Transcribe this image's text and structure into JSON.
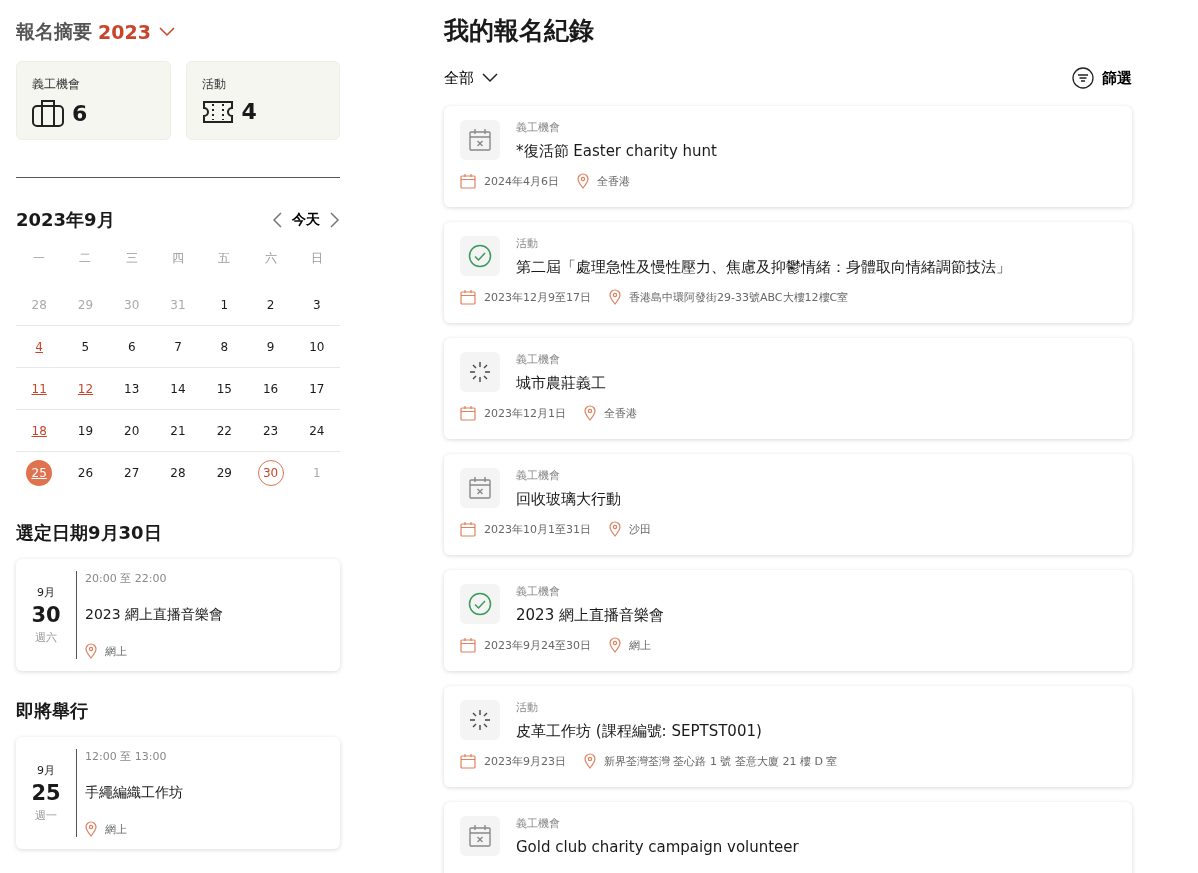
{
  "summary": {
    "title": "報名摘要",
    "year": "2023",
    "stats": [
      {
        "label": "義工機會",
        "count": "6",
        "kind": "bag"
      },
      {
        "label": "活動",
        "count": "4",
        "kind": "ticket"
      }
    ]
  },
  "calendar": {
    "month": "2023年9月",
    "today_button": "今天",
    "weekdays": [
      "一",
      "二",
      "三",
      "四",
      "五",
      "六",
      "日"
    ],
    "days": [
      {
        "label": "28",
        "kind": "outside",
        "selected": false
      },
      {
        "label": "29",
        "kind": "outside",
        "selected": false
      },
      {
        "label": "30",
        "kind": "outside",
        "selected": false
      },
      {
        "label": "31",
        "kind": "outside",
        "selected": false
      },
      {
        "label": "1",
        "kind": "plain",
        "selected": false
      },
      {
        "label": "2",
        "kind": "plain",
        "selected": false
      },
      {
        "label": "3",
        "kind": "plain",
        "selected": false
      },
      {
        "label": "4",
        "kind": "event",
        "selected": false
      },
      {
        "label": "5",
        "kind": "plain",
        "selected": false
      },
      {
        "label": "6",
        "kind": "plain",
        "selected": false
      },
      {
        "label": "7",
        "kind": "plain",
        "selected": false
      },
      {
        "label": "8",
        "kind": "plain",
        "selected": false
      },
      {
        "label": "9",
        "kind": "plain",
        "selected": false
      },
      {
        "label": "10",
        "kind": "plain",
        "selected": false
      },
      {
        "label": "11",
        "kind": "event",
        "selected": false
      },
      {
        "label": "12",
        "kind": "event",
        "selected": false
      },
      {
        "label": "13",
        "kind": "plain",
        "selected": false
      },
      {
        "label": "14",
        "kind": "plain",
        "selected": false
      },
      {
        "label": "15",
        "kind": "plain",
        "selected": false
      },
      {
        "label": "16",
        "kind": "plain",
        "selected": false
      },
      {
        "label": "17",
        "kind": "plain",
        "selected": false
      },
      {
        "label": "18",
        "kind": "event",
        "selected": false
      },
      {
        "label": "19",
        "kind": "plain",
        "selected": false
      },
      {
        "label": "20",
        "kind": "plain",
        "selected": false
      },
      {
        "label": "21",
        "kind": "plain",
        "selected": false
      },
      {
        "label": "22",
        "kind": "plain",
        "selected": false
      },
      {
        "label": "23",
        "kind": "plain",
        "selected": false
      },
      {
        "label": "24",
        "kind": "plain",
        "selected": false
      },
      {
        "label": "25",
        "kind": "today",
        "selected": false
      },
      {
        "label": "26",
        "kind": "plain",
        "selected": false
      },
      {
        "label": "27",
        "kind": "plain",
        "selected": false
      },
      {
        "label": "28",
        "kind": "plain",
        "selected": false
      },
      {
        "label": "29",
        "kind": "plain",
        "selected": false
      },
      {
        "label": "30",
        "kind": "plain",
        "selected": true
      },
      {
        "label": "1",
        "kind": "outside",
        "selected": false
      }
    ]
  },
  "sections": [
    {
      "title": "選定日期9月30日",
      "events": [
        {
          "month": "9月",
          "day": "30",
          "weekday": "週六",
          "time": "20:00 至 22:00",
          "name": "2023 網上直播音樂會",
          "location": "網上"
        }
      ]
    },
    {
      "title": "即將舉行",
      "events": [
        {
          "month": "9月",
          "day": "25",
          "weekday": "週一",
          "time": "12:00 至 13:00",
          "name": "手繩編織工作坊",
          "location": "網上"
        }
      ]
    }
  ],
  "records": {
    "title": "我的報名紀錄",
    "filter_dropdown": "全部",
    "filter_button": "篩選",
    "items": [
      {
        "kind": "cancelled",
        "category": "義工機會",
        "name": "*復活節 Easter charity hunt",
        "date": "2024年4月6日",
        "location": "全香港"
      },
      {
        "kind": "confirmed",
        "category": "活動",
        "name": "第二屆「處理急性及慢性壓力、焦慮及抑鬱情緒：身體取向情緒調節技法」",
        "date": "2023年12月9至17日",
        "location": "香港島中環阿發街29-33號ABC大樓12樓C室"
      },
      {
        "kind": "pending",
        "category": "義工機會",
        "name": "城市農莊義工",
        "date": "2023年12月1日",
        "location": "全香港"
      },
      {
        "kind": "cancelled",
        "category": "義工機會",
        "name": "回收玻璃大行動",
        "date": "2023年10月1至31日",
        "location": "沙田"
      },
      {
        "kind": "confirmed",
        "category": "義工機會",
        "name": "2023 網上直播音樂會",
        "date": "2023年9月24至30日",
        "location": "網上"
      },
      {
        "kind": "pending",
        "category": "活動",
        "name": "皮革工作坊 (課程編號: SEPTST001)",
        "date": "2023年9月23日",
        "location": "新界荃灣荃灣 荃心路 1 號 荃意大廈 21 樓 D 室"
      },
      {
        "kind": "cancelled",
        "category": "義工機會",
        "name": "Gold club charity campaign volunteer"
      }
    ]
  }
}
